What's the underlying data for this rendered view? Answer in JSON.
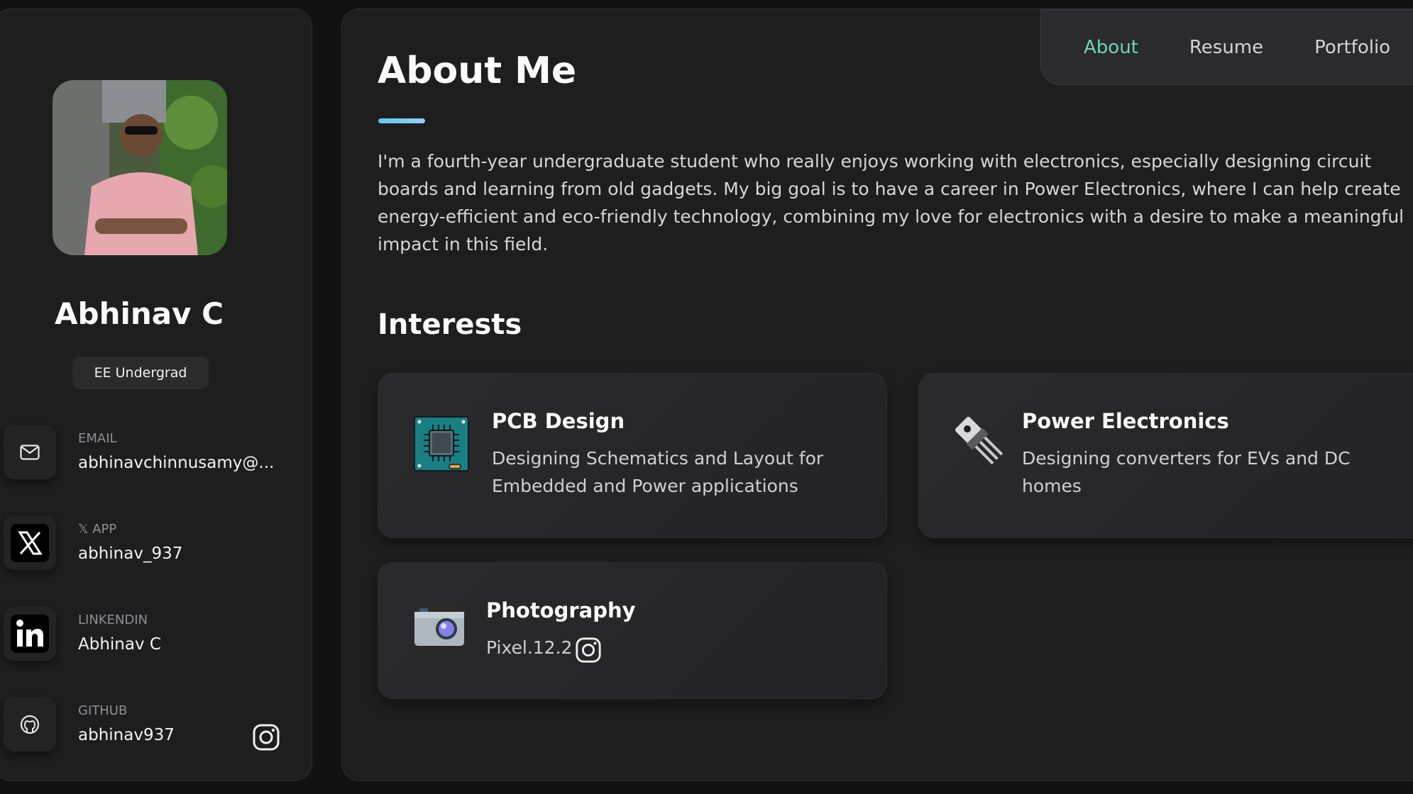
{
  "profile": {
    "name": "Abhinav C",
    "title": "EE Undergrad",
    "contacts": [
      {
        "label": "EMAIL",
        "value": "abhinavchinnusamy@..."
      },
      {
        "label": "𝕏 APP",
        "value": "abhinav_937"
      },
      {
        "label": "LINKENDIN",
        "value": "Abhinav C"
      },
      {
        "label": "GITHUB",
        "value": "abhinav937"
      }
    ]
  },
  "nav": {
    "items": [
      "About",
      "Resume",
      "Portfolio"
    ],
    "active": "About"
  },
  "about": {
    "title": "About Me",
    "text": "I'm a fourth-year undergraduate student who really enjoys working with electronics, especially designing circuit boards and learning from old gadgets. My big goal is to have a career in Power Electronics, where I can help create energy-efficient and eco-friendly technology, combining my love for electronics with a desire to make a meaningful impact in this field."
  },
  "interests": {
    "title": "Interests",
    "items": [
      {
        "title": "PCB Design",
        "text": "Designing Schematics and Layout for Embedded and Power applications",
        "icon": "pcb-chip-icon"
      },
      {
        "title": "Power Electronics",
        "text": "Designing converters for EVs and DC homes",
        "icon": "transistor-icon"
      },
      {
        "title": "Photography",
        "text": "Pixel.12.2",
        "icon": "camera-icon"
      }
    ]
  },
  "colors": {
    "accent": "#6bd3c0",
    "underline": "#64c5ee",
    "background": "#121212",
    "panel": "#1e1e1f"
  }
}
